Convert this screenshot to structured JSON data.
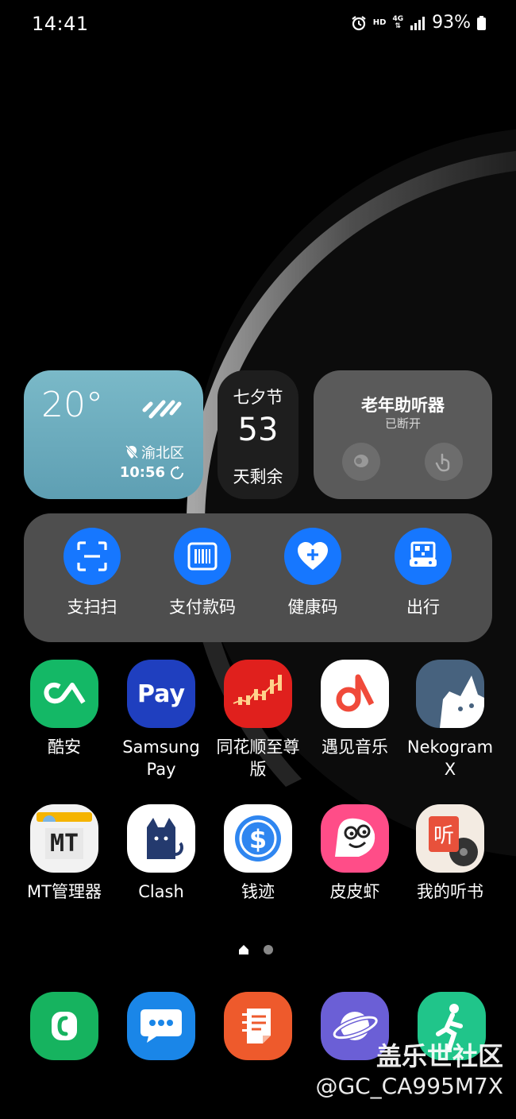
{
  "status_bar": {
    "time": "14:41",
    "hd": "HD",
    "network": "4G",
    "battery": "93%"
  },
  "weather": {
    "temp": "20°",
    "location": "渝北区",
    "time": "10:56"
  },
  "countdown": {
    "title": "七夕节",
    "days": "53",
    "suffix": "天剩余"
  },
  "hearing": {
    "title": "老年助听器",
    "status": "已断开"
  },
  "shortcuts": [
    {
      "label": "支扫扫",
      "icon": "scan-icon"
    },
    {
      "label": "支付款码",
      "icon": "barcode-icon"
    },
    {
      "label": "健康码",
      "icon": "heart-plus-icon"
    },
    {
      "label": "出行",
      "icon": "transit-code-icon"
    }
  ],
  "apps_row1": [
    {
      "label": "酷安"
    },
    {
      "label": "Samsung\nPay"
    },
    {
      "label": "同花顺至尊\n版"
    },
    {
      "label": "遇见音乐"
    },
    {
      "label": "Nekogram\nX"
    }
  ],
  "apps_row2": [
    {
      "label": "MT管理器",
      "icon_text": "MT"
    },
    {
      "label": "Clash"
    },
    {
      "label": "钱迹"
    },
    {
      "label": "皮皮虾"
    },
    {
      "label": "我的听书",
      "icon_text": "听"
    }
  ],
  "samsung_pay_icon_text": "Pay",
  "watermark": {
    "line1": "盖乐世社区",
    "line2": "@GC_CA995M7X"
  },
  "colors": {
    "accent_blue": "#1677ff",
    "weather_bg": "#6aaec0"
  }
}
